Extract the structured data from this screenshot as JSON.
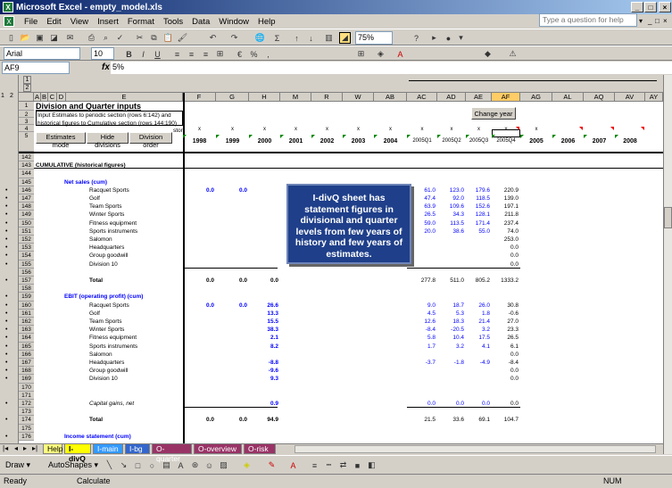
{
  "app": {
    "title": "Microsoft Excel - empty_model.xls",
    "logo": "X"
  },
  "window_controls": [
    "_",
    "□",
    "×"
  ],
  "doc_controls": [
    "_",
    "□",
    "×"
  ],
  "menu": [
    "File",
    "Edit",
    "View",
    "Insert",
    "Format",
    "Tools",
    "Data",
    "Window",
    "Help"
  ],
  "help_placeholder": "Type a question for help",
  "toolbar": {
    "zoom": "75%"
  },
  "formatbar": {
    "font": "Arial",
    "size": "10"
  },
  "formula": {
    "cell_ref": "AF9",
    "fx": "fx",
    "value": "5%"
  },
  "outline_levels": [
    "1",
    "2"
  ],
  "outline_cols": [
    "1",
    "2"
  ],
  "columns": [
    "A",
    "B",
    "C",
    "D",
    "E",
    "F",
    "G",
    "H",
    "M",
    "R",
    "W",
    "AB",
    "AC",
    "AD",
    "AE",
    "AF",
    "AG",
    "AL",
    "AQ",
    "AV",
    "AY"
  ],
  "header_rows": {
    "r1": {
      "num": "1",
      "text": "Division and Quarter inputs"
    },
    "r2": {
      "num": "2",
      "text": "Input Estimates to periodic section (rows 6:142) and"
    },
    "r3": {
      "num": "3",
      "text": "historical figures to Cumulative section (rows 144:190)"
    },
    "r4": {
      "num": "4",
      "text": "stor"
    },
    "r5": {
      "num": "5"
    },
    "btn_estimates": "Estimates mode",
    "btn_hide": "Hide divisions",
    "btn_order": "Division order",
    "btn_change_year": "Change year",
    "x_marks": [
      "x",
      "x",
      "x",
      "x",
      "x",
      "x",
      "x",
      "x",
      "x",
      "x",
      "x",
      "x"
    ],
    "years": [
      "1998",
      "1999",
      "2000",
      "2001",
      "2002",
      "2003",
      "2004",
      "2005Q1",
      "2005Q2",
      "2005Q3",
      "2005Q4",
      "2005",
      "2006",
      "2007",
      "2008"
    ]
  },
  "rows": [
    {
      "num": "142",
      "label": "",
      "indent": 0,
      "vals": []
    },
    {
      "num": "143",
      "label": "CUMULATIVE (historical figures)",
      "indent": 0,
      "bold": true,
      "vals": []
    },
    {
      "num": "144",
      "label": "",
      "indent": 0,
      "vals": []
    },
    {
      "num": "145",
      "label": "Net sales (cum)",
      "indent": 1,
      "bold": true,
      "blue": true,
      "vals": []
    },
    {
      "num": "146",
      "label": "Racquet Sports",
      "indent": 2,
      "f": "0.0",
      "g": "0.0",
      "h": "",
      "ac": "61.0",
      "ad": "123.0",
      "ae": "179.6",
      "af": "220.9"
    },
    {
      "num": "147",
      "label": "Golf",
      "indent": 2,
      "ac": "47.4",
      "ad": "92.0",
      "ae": "118.5",
      "af": "139.0"
    },
    {
      "num": "148",
      "label": "Team Sports",
      "indent": 2,
      "ac": "63.9",
      "ad": "109.6",
      "ae": "152.6",
      "af": "197.1"
    },
    {
      "num": "149",
      "label": "Winter Sports",
      "indent": 2,
      "ac": "26.5",
      "ad": "34.3",
      "ae": "128.1",
      "af": "211.8"
    },
    {
      "num": "150",
      "label": "Fitness equipment",
      "indent": 2,
      "ac": "59.0",
      "ad": "113.5",
      "ae": "171.4",
      "af": "237.4"
    },
    {
      "num": "151",
      "label": "Sports instruments",
      "indent": 2,
      "ac": "20.0",
      "ad": "38.6",
      "ae": "55.0",
      "af": "74.0"
    },
    {
      "num": "152",
      "label": "Salomon",
      "indent": 2,
      "af": "253.0"
    },
    {
      "num": "153",
      "label": "Headquarters",
      "indent": 2,
      "af": "0.0"
    },
    {
      "num": "154",
      "label": "Group goodwill",
      "indent": 2,
      "af": "0.0"
    },
    {
      "num": "155",
      "label": "Division 10",
      "indent": 2,
      "af": "0.0"
    },
    {
      "num": "156",
      "label": "",
      "indent": 0
    },
    {
      "num": "157",
      "label": "Total",
      "indent": 2,
      "bold": true,
      "f": "0.0",
      "g": "0.0",
      "h": "0.0",
      "ac": "277.8",
      "ad": "511.0",
      "ae": "805.2",
      "af": "1333.2",
      "total": true
    },
    {
      "num": "158",
      "label": "",
      "indent": 0
    },
    {
      "num": "159",
      "label": "EBIT (operating profit) (cum)",
      "indent": 1,
      "bold": true,
      "blue": true
    },
    {
      "num": "160",
      "label": "Racquet Sports",
      "indent": 2,
      "f": "0.0",
      "g": "0.0",
      "h": "26.6",
      "ac": "9.0",
      "ad": "18.7",
      "ae": "26.0",
      "af": "30.8"
    },
    {
      "num": "161",
      "label": "Golf",
      "indent": 2,
      "h": "13.3",
      "ac": "4.5",
      "ad": "5.3",
      "ae": "1.8",
      "af": "-0.6"
    },
    {
      "num": "162",
      "label": "Team Sports",
      "indent": 2,
      "h": "15.5",
      "ac": "12.6",
      "ad": "18.3",
      "ae": "21.4",
      "af": "27.0"
    },
    {
      "num": "163",
      "label": "Winter Sports",
      "indent": 2,
      "h": "38.3",
      "ac": "-8.4",
      "ad": "-20.5",
      "ae": "3.2",
      "af": "23.3"
    },
    {
      "num": "164",
      "label": "Fitness equipment",
      "indent": 2,
      "h": "2.1",
      "ac": "5.8",
      "ad": "10.4",
      "ae": "17.5",
      "af": "26.5"
    },
    {
      "num": "165",
      "label": "Sports instruments",
      "indent": 2,
      "h": "8.2",
      "ac": "1.7",
      "ad": "3.2",
      "ae": "4.1",
      "af": "6.1"
    },
    {
      "num": "166",
      "label": "Salomon",
      "indent": 2,
      "af": "0.0"
    },
    {
      "num": "167",
      "label": "Headquarters",
      "indent": 2,
      "h": "-8.8",
      "ac": "-3.7",
      "ad": "-1.8",
      "ae": "-4.9",
      "af": "-8.4"
    },
    {
      "num": "168",
      "label": "Group goodwill",
      "indent": 2,
      "h": "-9.6",
      "af": "0.0"
    },
    {
      "num": "169",
      "label": "Division 10",
      "indent": 2,
      "h": "9.3",
      "af": "0.0"
    },
    {
      "num": "170",
      "label": "",
      "indent": 0
    },
    {
      "num": "171",
      "label": "",
      "indent": 0
    },
    {
      "num": "172",
      "label": "Capital gains, net",
      "indent": 2,
      "italic": true,
      "h": "0.9",
      "ac": "0.0",
      "ad": "0.0",
      "ae": "0.0",
      "af": "0.0"
    },
    {
      "num": "173",
      "label": "",
      "indent": 0
    },
    {
      "num": "174",
      "label": "Total",
      "indent": 2,
      "bold": true,
      "f": "0.0",
      "g": "0.0",
      "h": "94.9",
      "ac": "21.5",
      "ad": "33.6",
      "ae": "69.1",
      "af": "104.7",
      "total": true
    },
    {
      "num": "175",
      "label": "",
      "indent": 0
    },
    {
      "num": "176",
      "label": "Income statement (cum)",
      "indent": 1,
      "bold": true,
      "blue": true
    }
  ],
  "callout": "I-divQ sheet has statement figures in divisional and quarter levels from few years of history and few years of estimates.",
  "tabs": [
    {
      "label": "Help",
      "bg": "#ffff80",
      "color": "#000"
    },
    {
      "label": "I-divQ",
      "bg": "#ffff00",
      "color": "#000",
      "active": true
    },
    {
      "label": "I-main",
      "bg": "#3399ff",
      "color": "#fff"
    },
    {
      "label": "I-bg",
      "bg": "#3366cc",
      "color": "#fff"
    },
    {
      "label": "O-quarter",
      "bg": "#993366",
      "color": "#fff"
    },
    {
      "label": "O-overview",
      "bg": "#993366",
      "color": "#fff"
    },
    {
      "label": "O-risk",
      "bg": "#993366",
      "color": "#fff"
    }
  ],
  "drawbar": {
    "draw": "Draw ▾",
    "autoshapes": "AutoShapes ▾"
  },
  "status": {
    "left": "Ready",
    "mode": "Calculate",
    "num": "NUM"
  }
}
